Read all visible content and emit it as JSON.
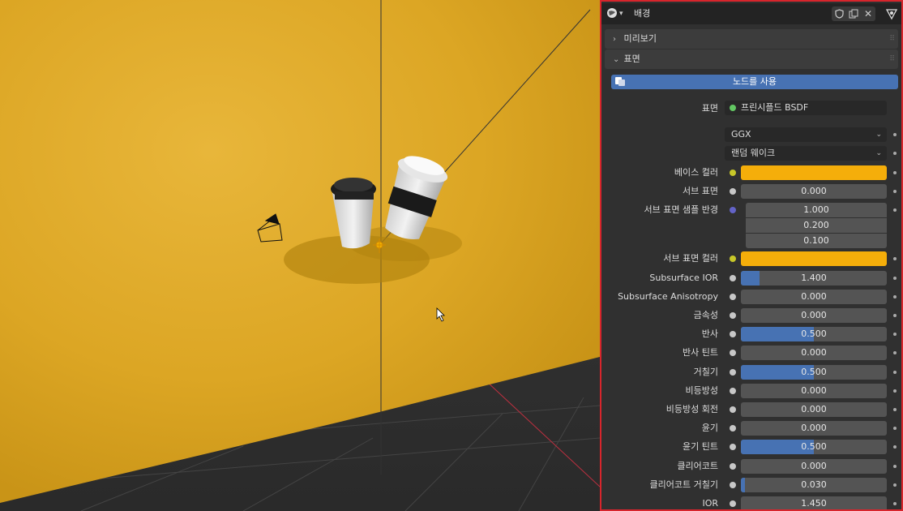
{
  "header": {
    "material_name": "배경",
    "icons": [
      "world-icon",
      "shield-icon",
      "copy-icon",
      "close-icon",
      "node-tree-icon"
    ]
  },
  "sections": {
    "preview_label": "미리보기",
    "surface_label": "표면"
  },
  "use_nodes_label": "노드를 사용",
  "surface": {
    "label": "표면",
    "value": "프린시플드 BSDF"
  },
  "distribution": "GGX",
  "subsurface_method": "랜덤 웨이크",
  "properties": [
    {
      "label": "베이스 컬러",
      "type": "color",
      "socket": "yellow",
      "color": "#f5ae0a"
    },
    {
      "label": "서브 표면",
      "type": "value",
      "socket": "gray",
      "value": "0.000",
      "fill": 0
    },
    {
      "label": "서브 표면 샘플 반경",
      "type": "vector",
      "socket": "purple",
      "values": [
        "1.000",
        "0.200",
        "0.100"
      ]
    },
    {
      "label": "서브 표면 컬러",
      "type": "color",
      "socket": "yellow",
      "color": "#f5ae0a"
    },
    {
      "label": "Subsurface IOR",
      "type": "value",
      "socket": "gray",
      "value": "1.400",
      "fill": 0.13
    },
    {
      "label": "Subsurface Anisotropy",
      "type": "value",
      "socket": "gray",
      "value": "0.000",
      "fill": 0
    },
    {
      "label": "금속성",
      "type": "value",
      "socket": "gray",
      "value": "0.000",
      "fill": 0
    },
    {
      "label": "반사",
      "type": "value",
      "socket": "gray",
      "value": "0.500",
      "fill": 0.5
    },
    {
      "label": "반사 틴트",
      "type": "value",
      "socket": "gray",
      "value": "0.000",
      "fill": 0
    },
    {
      "label": "거칠기",
      "type": "value",
      "socket": "gray",
      "value": "0.500",
      "fill": 0.5
    },
    {
      "label": "비등방성",
      "type": "value",
      "socket": "gray",
      "value": "0.000",
      "fill": 0
    },
    {
      "label": "비등방성 회전",
      "type": "value",
      "socket": "gray",
      "value": "0.000",
      "fill": 0
    },
    {
      "label": "윤기",
      "type": "value",
      "socket": "gray",
      "value": "0.000",
      "fill": 0
    },
    {
      "label": "윤기 틴트",
      "type": "value",
      "socket": "gray",
      "value": "0.500",
      "fill": 0.5
    },
    {
      "label": "클리어코트",
      "type": "value",
      "socket": "gray",
      "value": "0.000",
      "fill": 0
    },
    {
      "label": "클리어코트 거칠기",
      "type": "value",
      "socket": "gray",
      "value": "0.030",
      "fill": 0.03
    },
    {
      "label": "IOR",
      "type": "value",
      "socket": "gray",
      "value": "1.450",
      "fill": 0
    }
  ],
  "colors": {
    "accent": "#4772b3",
    "highlight_border": "#d8252c",
    "backdrop": "#e0a825"
  }
}
